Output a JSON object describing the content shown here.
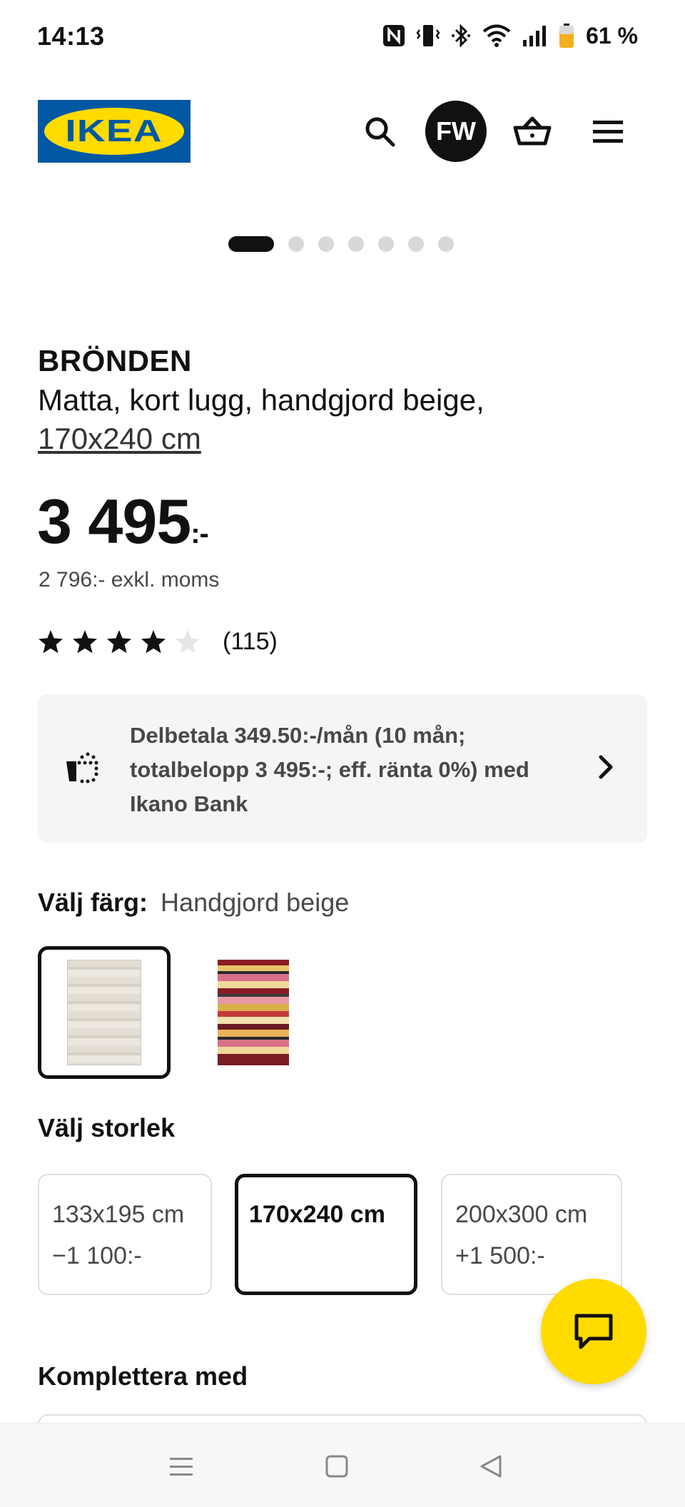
{
  "status_bar": {
    "time": "14:13",
    "battery_percent": "61 %",
    "icons": [
      "nfc-icon",
      "vibrate-icon",
      "bluetooth-icon",
      "wifi-icon",
      "signal-icon",
      "battery-icon"
    ]
  },
  "header": {
    "logo_text": "IKEA",
    "avatar_initials": "FW",
    "icons": [
      "search-icon",
      "cart-icon",
      "hamburger-menu-icon"
    ]
  },
  "carousel": {
    "total": 7,
    "active_index": 0
  },
  "product": {
    "name": "BRÖNDEN",
    "description": "Matta, kort lugg, handgjord beige,",
    "size_link": "170x240 cm",
    "price": "3 495",
    "price_suffix": ":-",
    "price_excl_vat": "2 796:- exkl. moms",
    "rating_stars": 4,
    "rating_max": 5,
    "review_count": "(115)"
  },
  "financing": {
    "text": "Delbetala 349.50:-/mån (10 mån; totalbelopp 3 495:-; eff. ränta 0%) med Ikano Bank"
  },
  "color_selection": {
    "label": "Välj färg:",
    "selected_value": "Handgjord beige",
    "options": [
      "Handgjord beige",
      "multicolor"
    ]
  },
  "size_selection": {
    "label": "Välj storlek",
    "options": [
      {
        "size": "133x195 cm",
        "price_diff": "−1 100:-"
      },
      {
        "size": "170x240 cm",
        "price_diff": ""
      },
      {
        "size": "200x300 cm",
        "price_diff": "+1 500:-"
      }
    ],
    "selected_index": 1
  },
  "complement": {
    "label": "Komplettera med"
  },
  "colors": {
    "ikea_blue": "#0058a3",
    "ikea_yellow": "#ffdb00",
    "text": "#111111",
    "muted": "#484848"
  }
}
